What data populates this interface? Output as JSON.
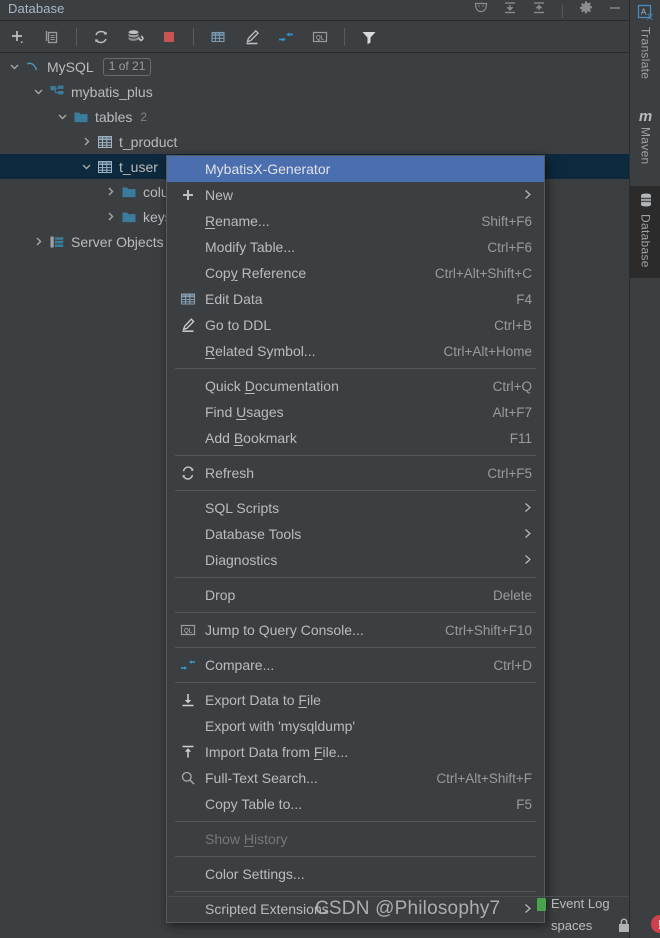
{
  "toolwindow": {
    "title": "Database",
    "header_icons": [
      "theater-masks-icon",
      "collapse-all-icon",
      "expand-all-icon",
      "gear-icon",
      "minimize-icon"
    ],
    "toolbar_icons": [
      "add-icon",
      "duplicate-icon",
      "refresh-icon",
      "data-source-properties-icon",
      "stop-icon",
      "edit-data-icon",
      "go-to-ddl-icon",
      "compare-icon",
      "query-console-icon",
      "filter-icon"
    ]
  },
  "tree": {
    "rows": [
      {
        "label": "MySQL",
        "icon": "mysql-dolphin-icon",
        "indent": 0,
        "twisty": "expanded",
        "badge": "1 of 21",
        "count": "",
        "selected": false
      },
      {
        "label": "mybatis_plus",
        "icon": "schema-icon",
        "indent": 1,
        "twisty": "expanded",
        "badge": "",
        "count": "",
        "selected": false
      },
      {
        "label": "tables",
        "icon": "folder-icon",
        "indent": 2,
        "twisty": "expanded",
        "badge": "",
        "count": "2",
        "selected": false
      },
      {
        "label": "t_product",
        "icon": "table-icon",
        "indent": 3,
        "twisty": "collapsed",
        "badge": "",
        "count": "",
        "selected": false
      },
      {
        "label": "t_user",
        "icon": "table-icon",
        "indent": 3,
        "twisty": "expanded",
        "badge": "",
        "count": "",
        "selected": true
      },
      {
        "label": "columns",
        "icon": "folder-icon",
        "indent": 4,
        "twisty": "collapsed",
        "badge": "",
        "count": "",
        "selected": false
      },
      {
        "label": "keys",
        "icon": "folder-icon",
        "indent": 4,
        "twisty": "collapsed",
        "badge": "",
        "count": "",
        "selected": false
      },
      {
        "label": "Server Objects",
        "icon": "server-objects-icon",
        "indent": 1,
        "twisty": "collapsed",
        "badge": "",
        "count": "",
        "selected": false
      }
    ]
  },
  "context_menu": {
    "items": [
      {
        "type": "item",
        "label": "MybatisX-Generator",
        "shortcut": "",
        "icon": "",
        "arrow": false,
        "selected": true,
        "disabled": false
      },
      {
        "type": "item",
        "label": "New",
        "shortcut": "",
        "icon": "plus-icon",
        "arrow": true,
        "selected": false,
        "disabled": false
      },
      {
        "type": "item",
        "label": "Rename...",
        "shortcut": "Shift+F6",
        "icon": "",
        "arrow": false,
        "selected": false,
        "disabled": false,
        "mnemonic": "R"
      },
      {
        "type": "item",
        "label": "Modify Table...",
        "shortcut": "Ctrl+F6",
        "icon": "",
        "arrow": false,
        "selected": false,
        "disabled": false
      },
      {
        "type": "item",
        "label": "Copy Reference",
        "shortcut": "Ctrl+Alt+Shift+C",
        "icon": "",
        "arrow": false,
        "selected": false,
        "disabled": false,
        "mnemonic": "y"
      },
      {
        "type": "item",
        "label": "Edit Data",
        "shortcut": "F4",
        "icon": "edit-data-icon",
        "arrow": false,
        "selected": false,
        "disabled": false
      },
      {
        "type": "item",
        "label": "Go to DDL",
        "shortcut": "Ctrl+B",
        "icon": "go-to-ddl-icon",
        "arrow": false,
        "selected": false,
        "disabled": false
      },
      {
        "type": "item",
        "label": "Related Symbol...",
        "shortcut": "Ctrl+Alt+Home",
        "icon": "",
        "arrow": false,
        "selected": false,
        "disabled": false,
        "mnemonic": "R"
      },
      {
        "type": "separator"
      },
      {
        "type": "item",
        "label": "Quick Documentation",
        "shortcut": "Ctrl+Q",
        "icon": "",
        "arrow": false,
        "selected": false,
        "disabled": false,
        "mnemonic": "D"
      },
      {
        "type": "item",
        "label": "Find Usages",
        "shortcut": "Alt+F7",
        "icon": "",
        "arrow": false,
        "selected": false,
        "disabled": false,
        "mnemonic": "U"
      },
      {
        "type": "item",
        "label": "Add Bookmark",
        "shortcut": "F11",
        "icon": "",
        "arrow": false,
        "selected": false,
        "disabled": false,
        "mnemonic": "B"
      },
      {
        "type": "separator"
      },
      {
        "type": "item",
        "label": "Refresh",
        "shortcut": "Ctrl+F5",
        "icon": "refresh-icon",
        "arrow": false,
        "selected": false,
        "disabled": false
      },
      {
        "type": "separator"
      },
      {
        "type": "item",
        "label": "SQL Scripts",
        "shortcut": "",
        "icon": "",
        "arrow": true,
        "selected": false,
        "disabled": false
      },
      {
        "type": "item",
        "label": "Database Tools",
        "shortcut": "",
        "icon": "",
        "arrow": true,
        "selected": false,
        "disabled": false
      },
      {
        "type": "item",
        "label": "Diagnostics",
        "shortcut": "",
        "icon": "",
        "arrow": true,
        "selected": false,
        "disabled": false
      },
      {
        "type": "separator"
      },
      {
        "type": "item",
        "label": "Drop",
        "shortcut": "Delete",
        "icon": "",
        "arrow": false,
        "selected": false,
        "disabled": false
      },
      {
        "type": "separator"
      },
      {
        "type": "item",
        "label": "Jump to Query Console...",
        "shortcut": "Ctrl+Shift+F10",
        "icon": "query-console-icon",
        "arrow": false,
        "selected": false,
        "disabled": false
      },
      {
        "type": "separator"
      },
      {
        "type": "item",
        "label": "Compare...",
        "shortcut": "Ctrl+D",
        "icon": "compare-icon",
        "arrow": false,
        "selected": false,
        "disabled": false
      },
      {
        "type": "separator"
      },
      {
        "type": "item",
        "label": "Export Data to File",
        "shortcut": "",
        "icon": "export-icon",
        "arrow": false,
        "selected": false,
        "disabled": false,
        "mnemonic": "F"
      },
      {
        "type": "item",
        "label": "Export with 'mysqldump'",
        "shortcut": "",
        "icon": "",
        "arrow": false,
        "selected": false,
        "disabled": false
      },
      {
        "type": "item",
        "label": "Import Data from File...",
        "shortcut": "",
        "icon": "import-icon",
        "arrow": false,
        "selected": false,
        "disabled": false,
        "mnemonic": "F"
      },
      {
        "type": "item",
        "label": "Full-Text Search...",
        "shortcut": "Ctrl+Alt+Shift+F",
        "icon": "search-icon",
        "arrow": false,
        "selected": false,
        "disabled": false
      },
      {
        "type": "item",
        "label": "Copy Table to...",
        "shortcut": "F5",
        "icon": "",
        "arrow": false,
        "selected": false,
        "disabled": false
      },
      {
        "type": "separator"
      },
      {
        "type": "item",
        "label": "Show History",
        "shortcut": "",
        "icon": "",
        "arrow": false,
        "selected": false,
        "disabled": true,
        "mnemonic": "H"
      },
      {
        "type": "separator"
      },
      {
        "type": "item",
        "label": "Color Settings...",
        "shortcut": "",
        "icon": "",
        "arrow": false,
        "selected": false,
        "disabled": false
      },
      {
        "type": "separator"
      },
      {
        "type": "item",
        "label": "Scripted Extensions",
        "shortcut": "",
        "icon": "",
        "arrow": true,
        "selected": false,
        "disabled": false
      }
    ]
  },
  "right_stripe": {
    "buttons": [
      {
        "label": "Translate",
        "icon": "translate-icon",
        "active": false
      },
      {
        "label": "Maven",
        "icon": "maven-m-icon",
        "active": false
      },
      {
        "label": "Database",
        "icon": "database-cylinder-icon",
        "active": true
      }
    ]
  },
  "status_bar": {
    "event_log": "Event Log",
    "indent": "spaces",
    "lock": "lock-icon",
    "error_count": "!"
  },
  "watermark": "CSDN @Philosophy7",
  "colors": {
    "background": "#3c3f41",
    "menu_selection": "#4b6eaf",
    "tree_selection": "#0d293e",
    "accent_blue": "#3592c4",
    "folder_blue": "#3b7b9b",
    "stop_red": "#c75450",
    "error_red": "#d0414c",
    "text": "#bbbbbb",
    "text_muted": "#9a9a9a",
    "text_disabled": "#777777"
  }
}
